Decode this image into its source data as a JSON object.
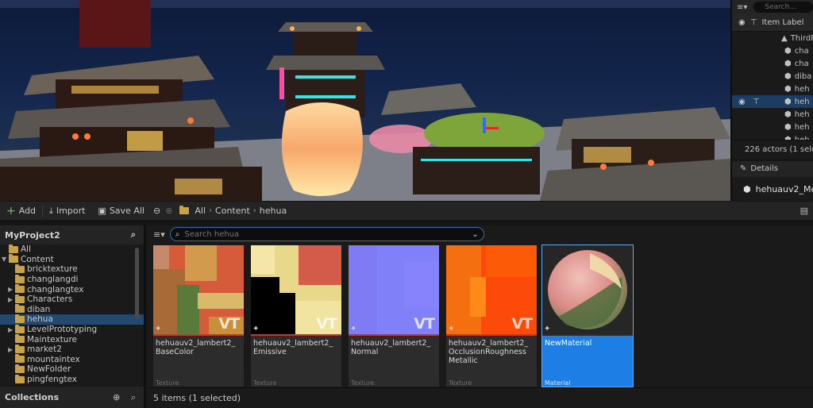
{
  "outliner": {
    "search_placeholder": "Search...",
    "column_label": "Item Label",
    "root_item": "ThirdP",
    "rows": [
      "cha",
      "cha",
      "diba",
      "heh",
      "heh",
      "heh",
      "heh",
      "heh"
    ],
    "actor_count": "226 actors (1 selec"
  },
  "details": {
    "tab_label": "Details",
    "selected_name": "hehuauv2_Me"
  },
  "toolbar": {
    "add_label": "Add",
    "import_label": "Import",
    "save_all_label": "Save All",
    "breadcrumb": [
      "All",
      "Content",
      "hehua"
    ]
  },
  "tree": {
    "project": "MyProject2",
    "items": [
      {
        "label": "All",
        "depth": 0,
        "caret": "",
        "selected": false
      },
      {
        "label": "Content",
        "depth": 0,
        "caret": "▼",
        "selected": false
      },
      {
        "label": "bricktexture",
        "depth": 1,
        "caret": "",
        "selected": false
      },
      {
        "label": "changlangdi",
        "depth": 1,
        "caret": "",
        "selected": false
      },
      {
        "label": "changlangtex",
        "depth": 1,
        "caret": "▶",
        "selected": false
      },
      {
        "label": "Characters",
        "depth": 1,
        "caret": "▶",
        "selected": false
      },
      {
        "label": "diban",
        "depth": 1,
        "caret": "",
        "selected": false
      },
      {
        "label": "hehua",
        "depth": 1,
        "caret": "",
        "selected": true
      },
      {
        "label": "LevelPrototyping",
        "depth": 1,
        "caret": "▶",
        "selected": false
      },
      {
        "label": "Maintexture",
        "depth": 1,
        "caret": "",
        "selected": false
      },
      {
        "label": "market2",
        "depth": 1,
        "caret": "▶",
        "selected": false
      },
      {
        "label": "mountaintex",
        "depth": 1,
        "caret": "",
        "selected": false
      },
      {
        "label": "NewFolder",
        "depth": 1,
        "caret": "",
        "selected": false
      },
      {
        "label": "pingfengtex",
        "depth": 1,
        "caret": "",
        "selected": false
      }
    ]
  },
  "collections": {
    "label": "Collections"
  },
  "assets": {
    "search_placeholder": "Search hehua",
    "items": [
      {
        "name": "hehuauv2_lambert2_ BaseColor",
        "type": "Texture",
        "vt": "VT"
      },
      {
        "name": "hehuauv2_lambert2_ Emissive",
        "type": "Texture",
        "vt": "VT"
      },
      {
        "name": "hehuauv2_lambert2_ Normal",
        "type": "Texture",
        "vt": "VT"
      },
      {
        "name": "hehuauv2_lambert2_ OcclusionRoughness Metallic",
        "type": "Texture",
        "vt": "VT"
      },
      {
        "name": "NewMaterial",
        "type": "Material",
        "vt": ""
      }
    ],
    "status": "5 items (1 selected)"
  },
  "colors": {
    "accent": "#1d7fe6",
    "folder": "#c9a34a",
    "texture_bar": "#c23a2a"
  }
}
